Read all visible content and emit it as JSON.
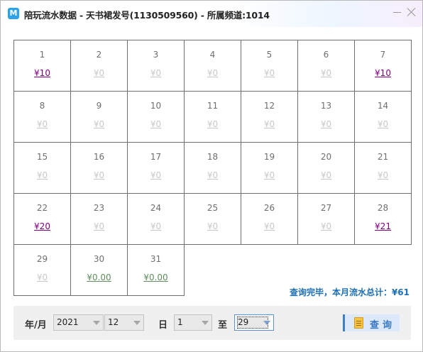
{
  "window": {
    "icon_letter": "M",
    "title": "陪玩流水数据 - 天书裙发号(1130509560) - 所属频道:1014"
  },
  "calendar": {
    "days": [
      {
        "day": "1",
        "amount": "¥10",
        "style": "pos"
      },
      {
        "day": "2",
        "amount": "¥0",
        "style": "dim"
      },
      {
        "day": "3",
        "amount": "¥0",
        "style": "dim"
      },
      {
        "day": "4",
        "amount": "¥0",
        "style": "dim"
      },
      {
        "day": "5",
        "amount": "¥0",
        "style": "dim"
      },
      {
        "day": "6",
        "amount": "¥0",
        "style": "dim"
      },
      {
        "day": "7",
        "amount": "¥10",
        "style": "pos"
      },
      {
        "day": "8",
        "amount": "¥0",
        "style": "dim"
      },
      {
        "day": "9",
        "amount": "¥0",
        "style": "dim"
      },
      {
        "day": "10",
        "amount": "¥0",
        "style": "dim"
      },
      {
        "day": "11",
        "amount": "¥0",
        "style": "dim"
      },
      {
        "day": "12",
        "amount": "¥0",
        "style": "dim"
      },
      {
        "day": "13",
        "amount": "¥0",
        "style": "dim"
      },
      {
        "day": "14",
        "amount": "¥0",
        "style": "dim"
      },
      {
        "day": "15",
        "amount": "¥0",
        "style": "dim"
      },
      {
        "day": "16",
        "amount": "¥0",
        "style": "dim"
      },
      {
        "day": "17",
        "amount": "¥0",
        "style": "dim"
      },
      {
        "day": "18",
        "amount": "¥0",
        "style": "dim"
      },
      {
        "day": "19",
        "amount": "¥0",
        "style": "dim"
      },
      {
        "day": "20",
        "amount": "¥0",
        "style": "dim"
      },
      {
        "day": "21",
        "amount": "¥0",
        "style": "dim"
      },
      {
        "day": "22",
        "amount": "¥20",
        "style": "pos"
      },
      {
        "day": "23",
        "amount": "¥0",
        "style": "dim"
      },
      {
        "day": "24",
        "amount": "¥0",
        "style": "dim"
      },
      {
        "day": "25",
        "amount": "¥0",
        "style": "dim"
      },
      {
        "day": "26",
        "amount": "¥0",
        "style": "dim"
      },
      {
        "day": "27",
        "amount": "¥0",
        "style": "dim"
      },
      {
        "day": "28",
        "amount": "¥21",
        "style": "pos"
      },
      {
        "day": "29",
        "amount": "¥0",
        "style": "dim"
      },
      {
        "day": "30",
        "amount": "¥0.00",
        "style": "green"
      },
      {
        "day": "31",
        "amount": "¥0.00",
        "style": "green"
      }
    ]
  },
  "summary": "查询完毕，本月流水总计：¥61",
  "filters": {
    "year_month_label": "年/月",
    "year": "2021",
    "month": "12",
    "day_label": "日",
    "from_day": "1",
    "to_label": "至",
    "to_day": "29",
    "query_label": "查询"
  },
  "colors": {
    "positive_amount": "#800080",
    "zero_amount": "#c9c9c9",
    "green_amount": "#5f8e5f",
    "summary": "#1d6fb5",
    "accent": "#3f7ec9"
  },
  "icons": {
    "app": "app-icon",
    "minimize": "minimize-icon",
    "close": "close-icon",
    "query": "document-icon",
    "dropdown": "chevron-down-icon"
  }
}
